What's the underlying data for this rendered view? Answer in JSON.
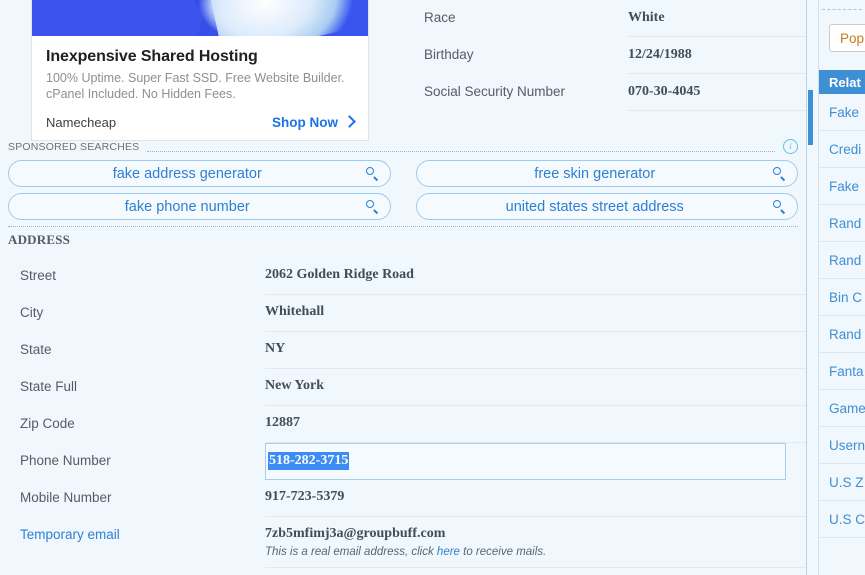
{
  "ad": {
    "title": "Inexpensive Shared Hosting",
    "description": "100% Uptime. Super Fast SSD. Free Website Builder. cPanel Included. No Hidden Fees.",
    "brand": "Namecheap",
    "cta": "Shop Now"
  },
  "top_fields": [
    {
      "label": "Race",
      "value": "White"
    },
    {
      "label": "Birthday",
      "value": "12/24/1988"
    },
    {
      "label": "Social Security Number",
      "value": "070-30-4045"
    }
  ],
  "sponsored": {
    "heading": "SPONSORED SEARCHES",
    "items": [
      "fake address generator",
      "free skin generator",
      "fake phone number",
      "united states street address"
    ]
  },
  "address": {
    "title": "ADDRESS",
    "fields": [
      {
        "label": "Street",
        "value": "2062  Golden Ridge Road"
      },
      {
        "label": "City",
        "value": "Whitehall"
      },
      {
        "label": "State",
        "value": "NY"
      },
      {
        "label": "State Full",
        "value": "New York"
      },
      {
        "label": "Zip Code",
        "value": "12887"
      },
      {
        "label": "Phone Number",
        "value": "518-282-3715"
      },
      {
        "label": "Mobile Number",
        "value": "917-723-5379"
      }
    ],
    "email": {
      "label": "Temporary email",
      "value": "7zb5mfimj3a@groupbuff.com",
      "note_before": "This is a real email address, click ",
      "note_link": "here",
      "note_after": " to receive mails."
    }
  },
  "sidebar": {
    "button_label": "Pop",
    "header": "Relat",
    "items": [
      "Fake ",
      "Credi",
      "Fake ",
      "Rand",
      "Rand",
      "Bin C",
      "Rand",
      "Fanta",
      "Game",
      "Usern",
      "U.S Z",
      "U.S C"
    ]
  },
  "colors": {
    "accent_blue": "#3f8fd4",
    "link_blue": "#2f7fd4",
    "selection_blue": "#3b8cf5",
    "page_bg": "#f0f7fd"
  }
}
